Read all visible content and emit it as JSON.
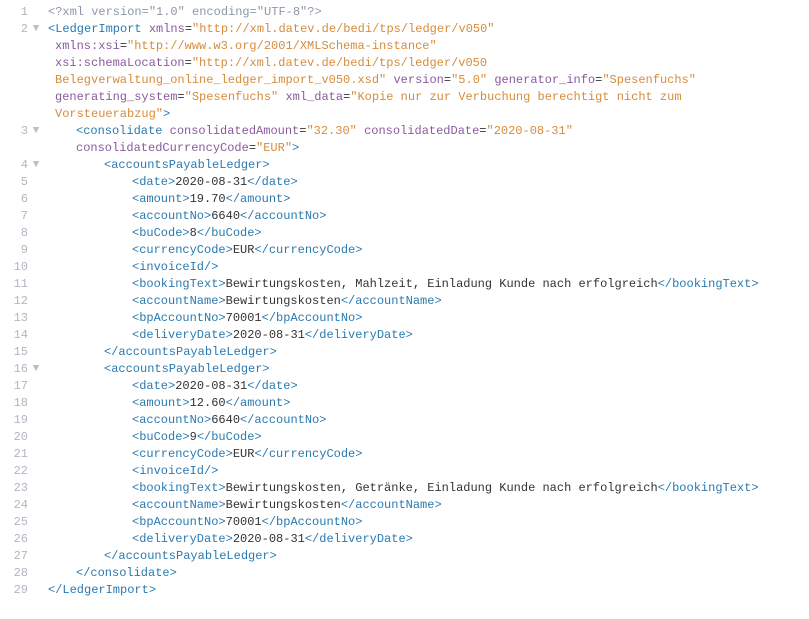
{
  "line_numbers": [
    "1",
    "2",
    "3",
    "4",
    "5",
    "6",
    "7",
    "8",
    "9",
    "10",
    "11",
    "12",
    "13",
    "14",
    "15",
    "16",
    "17",
    "18",
    "19",
    "20",
    "21",
    "22",
    "23",
    "24",
    "25",
    "26",
    "27",
    "28",
    "29"
  ],
  "fold_markers": {
    "2": "▼",
    "3": "▼",
    "4": "▼",
    "16": "▼"
  },
  "xml": {
    "prolog": "<?xml version=\"1.0\" encoding=\"UTF-8\"?>",
    "root": {
      "name": "LedgerImport",
      "attrs": {
        "xmlns": "http://xml.datev.de/bedi/tps/ledger/v050",
        "xmlns:xsi": "http://www.w3.org/2001/XMLSchema-instance",
        "xsi:schemaLocation": "http://xml.datev.de/bedi/tps/ledger/v050 Belegverwaltung_online_ledger_import_v050.xsd",
        "version": "5.0",
        "generator_info": "Spesenfuchs",
        "generating_system": "Spesenfuchs",
        "xml_data": "Kopie nur zur Verbuchung berechtigt nicht zum Vorsteuerabzug"
      }
    },
    "consolidate": {
      "name": "consolidate",
      "attrs": {
        "consolidatedAmount": "32.30",
        "consolidatedDate": "2020-08-31",
        "consolidatedCurrencyCode": "EUR"
      }
    },
    "ledger_tag": "accountsPayableLedger",
    "ledgers": [
      {
        "date": "2020-08-31",
        "amount": "19.70",
        "accountNo": "6640",
        "buCode": "8",
        "currencyCode": "EUR",
        "invoiceId": "",
        "bookingText": "Bewirtungskosten, Mahlzeit, Einladung Kunde nach erfolgreich",
        "accountName": "Bewirtungskosten",
        "bpAccountNo": "70001",
        "deliveryDate": "2020-08-31"
      },
      {
        "date": "2020-08-31",
        "amount": "12.60",
        "accountNo": "6640",
        "buCode": "9",
        "currencyCode": "EUR",
        "invoiceId": "",
        "bookingText": "Bewirtungskosten, Getränke, Einladung Kunde nach erfolgreich",
        "accountName": "Bewirtungskosten",
        "bpAccountNo": "70001",
        "deliveryDate": "2020-08-31"
      }
    ]
  }
}
